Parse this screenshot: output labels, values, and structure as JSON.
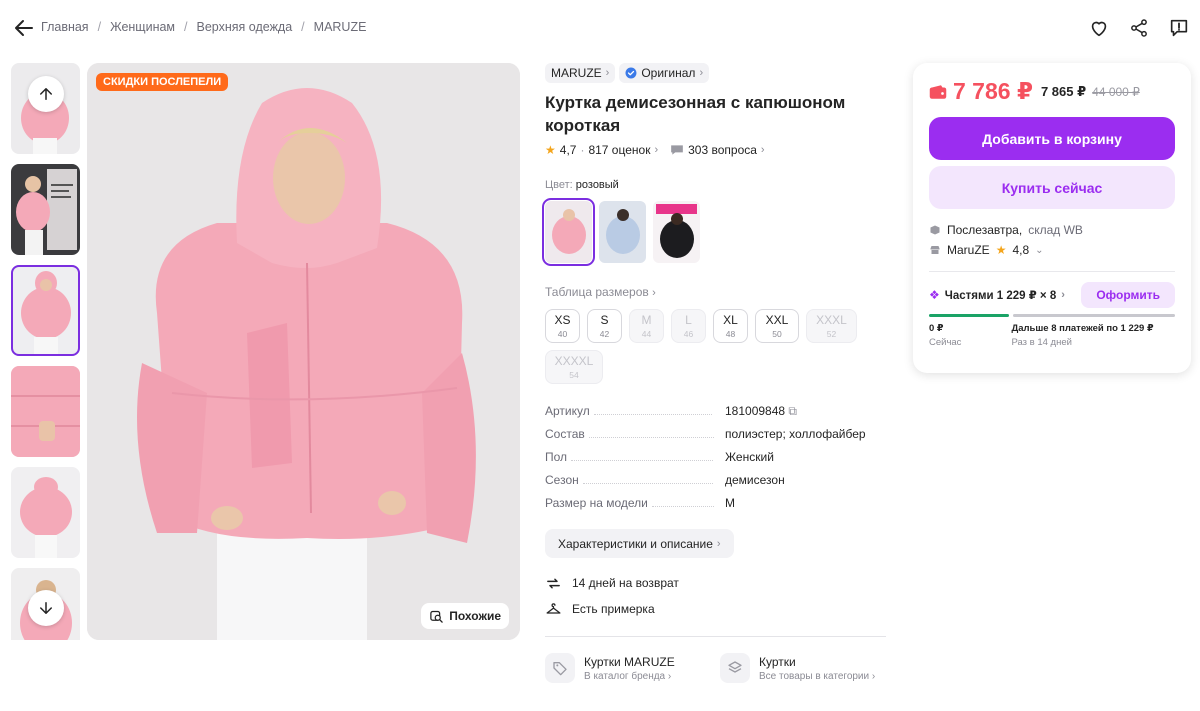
{
  "breadcrumbs": [
    "Главная",
    "Женщинам",
    "Верхняя одежда",
    "MARUZE"
  ],
  "gallery": {
    "promo_badge": "СКИДКИ ПОСЛЕПЕЛИ",
    "similar_label": "Похожие"
  },
  "product": {
    "brand": "MARUZE",
    "original_label": "Оригинал",
    "title": "Куртка демисезонная с капюшоном короткая",
    "rating": "4,7",
    "reviews": "817 оценок",
    "questions": "303 вопроса",
    "color_label": "Цвет:",
    "color_value": "розовый",
    "size_table_label": "Таблица размеров",
    "sizes": [
      {
        "size": "XS",
        "ru": "40"
      },
      {
        "size": "S",
        "ru": "42"
      },
      {
        "size": "M",
        "ru": "44"
      },
      {
        "size": "L",
        "ru": "46"
      },
      {
        "size": "XL",
        "ru": "48"
      },
      {
        "size": "XXL",
        "ru": "50"
      },
      {
        "size": "XXXL",
        "ru": "52"
      },
      {
        "size": "XXXXL",
        "ru": "54"
      }
    ],
    "specs": [
      {
        "key": "Артикул",
        "value": "181009848"
      },
      {
        "key": "Состав",
        "value": "полиэстер; холлофайбер"
      },
      {
        "key": "Пол",
        "value": "Женский"
      },
      {
        "key": "Сезон",
        "value": "демисезон"
      },
      {
        "key": "Размер на модели",
        "value": "M"
      }
    ],
    "characteristics_button": "Характеристики и описание",
    "features": [
      "14 дней на возврат",
      "Есть примерка"
    ],
    "links": [
      {
        "title": "Куртки MARUZE",
        "subtitle": "В каталог бренда"
      },
      {
        "title": "Куртки",
        "subtitle": "Все товары в категории"
      }
    ]
  },
  "buy": {
    "price": "7 786 ₽",
    "price_secondary": "7 865 ₽",
    "old_price": "44 000 ₽",
    "add_to_cart": "Добавить в корзину",
    "buy_now": "Купить сейчас",
    "delivery_when": "Послезавтра,",
    "delivery_where": "склад WB",
    "seller": "MaruZE",
    "seller_rating": "4,8",
    "installments": "Частями 1 229 ₽ × 8",
    "installments_button": "Оформить",
    "plan_now_amount": "0 ₽",
    "plan_now_label": "Сейчас",
    "plan_later_amount": "Дальше 8 платежей по 1 229 ₽",
    "plan_later_label": "Раз в 14 дней"
  },
  "colors": {
    "accent": "#9b2df0",
    "price": "#f5515f",
    "promo": "#ff6a1a",
    "jacket": "#f4a9b8"
  }
}
